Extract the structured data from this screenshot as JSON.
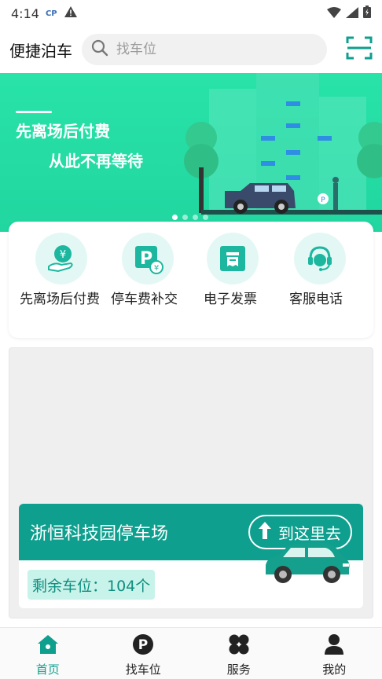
{
  "status_bar": {
    "time": "4:14",
    "carrier_badge": "CP"
  },
  "header": {
    "title": "便捷泊车",
    "search": {
      "placeholder": "找车位",
      "icon": "search-icon"
    },
    "scan_icon": "scan-icon"
  },
  "banner": {
    "title": "先离场后付费",
    "subtitle": "从此不再等待",
    "dots_count": 4,
    "active_dot": 1
  },
  "quick_actions": [
    {
      "label": "先离场后付费",
      "icon": "pay-later-icon"
    },
    {
      "label": "停车费补交",
      "icon": "parking-fee-icon"
    },
    {
      "label": "电子发票",
      "icon": "invoice-icon"
    },
    {
      "label": "客服电话",
      "icon": "customer-service-icon"
    }
  ],
  "parking_card": {
    "name": "浙恒科技园停车场",
    "go_label": "到这里去",
    "spaces_text": "剩余车位：104个"
  },
  "tabbar": [
    {
      "label": "首页",
      "icon": "home-icon",
      "active": true
    },
    {
      "label": "找车位",
      "icon": "parking-icon",
      "active": false
    },
    {
      "label": "服务",
      "icon": "services-icon",
      "active": false
    },
    {
      "label": "我的",
      "icon": "profile-icon",
      "active": false
    }
  ],
  "colors": {
    "accent": "#0e9f8e",
    "banner": "#21d6a0",
    "badge_bg": "#c8f3ea"
  }
}
